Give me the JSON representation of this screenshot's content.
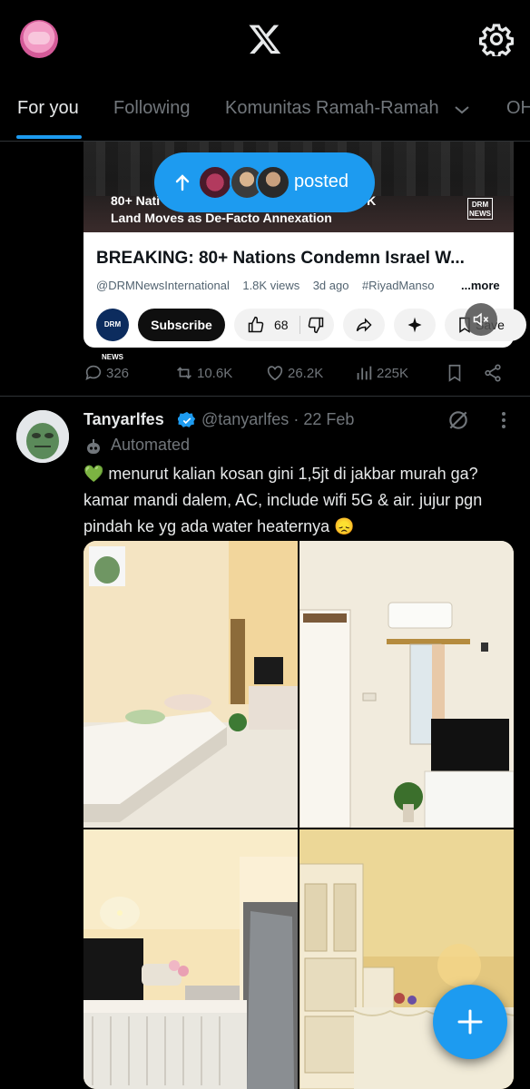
{
  "header": {
    "logo": "x-logo-icon",
    "avatar": "profile-avatar",
    "settings_icon": "gear-icon"
  },
  "tabs": [
    {
      "label": "For you",
      "active": true
    },
    {
      "label": "Following"
    },
    {
      "label": "Komunitas Ramah-Ramah"
    },
    {
      "label": "OH"
    }
  ],
  "posted_pill": {
    "label": "posted"
  },
  "video_post": {
    "thumbnail_caption_lines": [
      "80+ Nati",
      "Land Moves as De-Facto Annexation"
    ],
    "thumbnail_caption_tail": "K",
    "drm_logo_top": "DRM",
    "drm_logo_bottom": "NEWS",
    "card_title": "BREAKING: 80+ Nations Condemn Israel W...",
    "channel": "@DRMNewsInternational",
    "views": "1.8K views",
    "age": "3d ago",
    "hashtag": "#RiyadManso",
    "more_label": "...more",
    "channel_avatar_text": "DRM NEWS",
    "subscribe_label": "Subscribe",
    "like_count": "68",
    "save_label": "Save"
  },
  "video_post_actions": {
    "replies": "326",
    "reposts": "10.6K",
    "likes": "26.2K",
    "views": "225K"
  },
  "post2": {
    "display_name": "Tanyarlfes",
    "handle": "@tanyarlfes",
    "date": "22 Feb",
    "separator": "·",
    "automated_label": "Automated",
    "text": "💚 menurut kalian kosan gini 1,5jt di jakbar murah ga? kamar mandi dalem, AC, include wifi 5G & air. jujur pgn pindah ke yg ada water heaternya 😞",
    "images": [
      "bedroom-photo",
      "ac-tv-photo",
      "kitchen-photo",
      "wardrobe-photo"
    ]
  },
  "colors": {
    "accent": "#1d9bf0",
    "text_primary": "#e7e9ea",
    "text_secondary": "#71767b",
    "divider": "#2f3336"
  }
}
